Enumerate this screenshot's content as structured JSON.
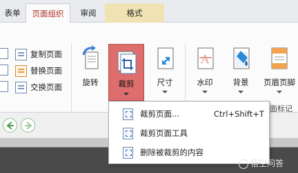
{
  "tabs": [
    {
      "label": "表单"
    },
    {
      "label": "页面组织"
    },
    {
      "label": "审阅"
    },
    {
      "label": "格式"
    }
  ],
  "small_buttons": [
    {
      "label": "复制页面",
      "icon": "copy-page-icon"
    },
    {
      "label": "替换页面",
      "icon": "replace-page-icon"
    },
    {
      "label": "交换页面",
      "icon": "swap-page-icon"
    }
  ],
  "big_buttons": {
    "rotate": {
      "label": "旋转",
      "icon": "rotate-icon"
    },
    "crop": {
      "label": "裁剪",
      "icon": "crop-icon"
    },
    "size": {
      "label": "尺寸",
      "icon": "resize-icon"
    },
    "watermark": {
      "label": "水印",
      "icon": "watermark-icon"
    },
    "background": {
      "label": "背景",
      "icon": "background-icon"
    },
    "header_footer": {
      "label": "页眉页脚",
      "icon": "header-footer-icon"
    }
  },
  "group_label": "面标记",
  "crop_menu": [
    {
      "label": "裁剪页面...",
      "shortcut": "Ctrl+Shift+T"
    },
    {
      "label": "裁剪页面工具",
      "shortcut": ""
    },
    {
      "label": "删除被裁剪的内容",
      "shortcut": ""
    }
  ],
  "watermark_text": "悟空问答",
  "colors": {
    "active_tab_text": "#b1302a",
    "crop_highlight": "#de6e6e",
    "format_tab_bg": "#efe3b4"
  }
}
